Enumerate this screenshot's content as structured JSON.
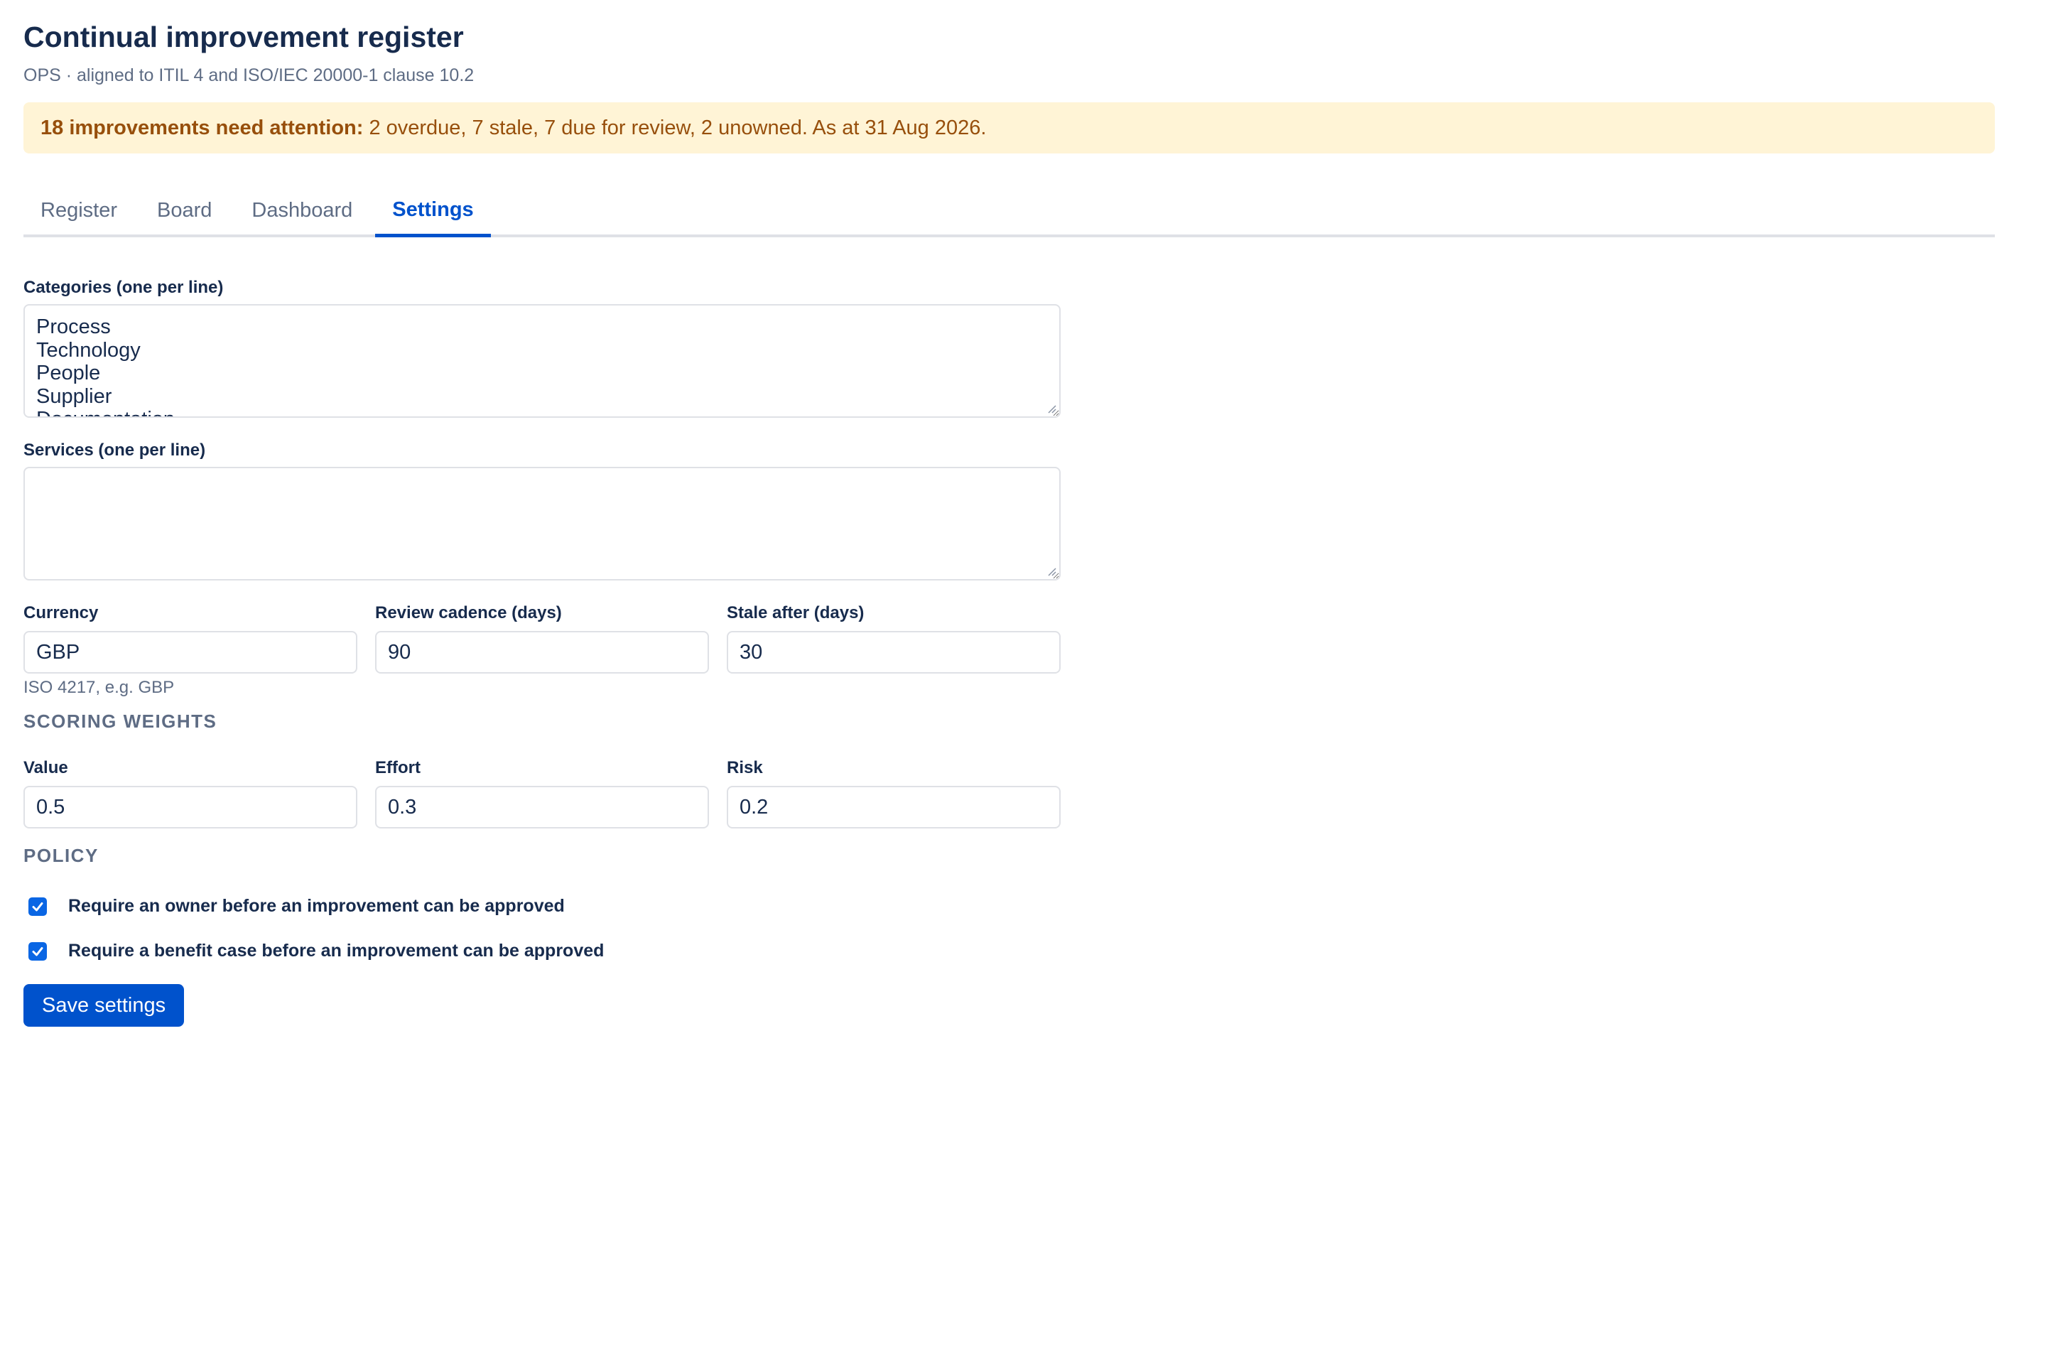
{
  "header": {
    "title": "Continual improvement register",
    "subtitle": "OPS · aligned to ITIL 4 and ISO/IEC 20000-1 clause 10.2"
  },
  "alert": {
    "strong": "18 improvements need attention:",
    "text": "2 overdue, 7 stale, 7 due for review, 2 unowned. As at 31 Aug 2026."
  },
  "tabs": [
    {
      "label": "Register",
      "active": false
    },
    {
      "label": "Board",
      "active": false
    },
    {
      "label": "Dashboard",
      "active": false
    },
    {
      "label": "Settings",
      "active": true
    }
  ],
  "settings": {
    "categories": {
      "label": "Categories (one per line)",
      "lines": [
        "Process",
        "Technology",
        "People",
        "Supplier",
        "Documentation"
      ]
    },
    "services": {
      "label": "Services (one per line)",
      "value": ""
    },
    "currency": {
      "label": "Currency",
      "value": "GBP",
      "help": "ISO 4217, e.g. GBP"
    },
    "review_cadence": {
      "label": "Review cadence (days)",
      "value": "90"
    },
    "stale_after": {
      "label": "Stale after (days)",
      "value": "30"
    },
    "scoring_heading": "SCORING WEIGHTS",
    "weights": {
      "value": {
        "label": "Value",
        "value": "0.5"
      },
      "effort": {
        "label": "Effort",
        "value": "0.3"
      },
      "risk": {
        "label": "Risk",
        "value": "0.2"
      }
    },
    "policy_heading": "POLICY",
    "policy": {
      "require_owner": {
        "label": "Require an owner before an improvement can be approved",
        "checked": true
      },
      "require_benefit": {
        "label": "Require a benefit case before an improvement can be approved",
        "checked": true
      }
    },
    "save_label": "Save settings"
  },
  "colors": {
    "accent": "#0052cc",
    "alert_bg": "#fff4d6",
    "alert_text": "#974f0c",
    "checkbox": "#0a66e4"
  }
}
